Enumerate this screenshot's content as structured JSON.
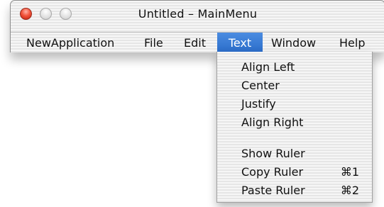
{
  "window": {
    "title": "Untitled – MainMenu",
    "controls": {
      "close": "close-button",
      "minimize": "minimize-button",
      "zoom": "zoom-button"
    }
  },
  "menubar": {
    "items": [
      {
        "label": "NewApplication",
        "active": false
      },
      {
        "label": "File",
        "active": false
      },
      {
        "label": "Edit",
        "active": false
      },
      {
        "label": "Text",
        "active": true
      },
      {
        "label": "Window",
        "active": false
      },
      {
        "label": "Help",
        "active": false
      }
    ]
  },
  "text_menu": {
    "group1": [
      {
        "label": "Align Left",
        "shortcut": ""
      },
      {
        "label": "Center",
        "shortcut": ""
      },
      {
        "label": "Justify",
        "shortcut": ""
      },
      {
        "label": "Align Right",
        "shortcut": ""
      }
    ],
    "group2": [
      {
        "label": "Show Ruler",
        "shortcut": ""
      },
      {
        "label": "Copy Ruler",
        "shortcut": "⌘1"
      },
      {
        "label": "Paste Ruler",
        "shortcut": "⌘2"
      }
    ]
  },
  "colors": {
    "selection": "#3a7bd5",
    "close_red": "#e0442d"
  }
}
